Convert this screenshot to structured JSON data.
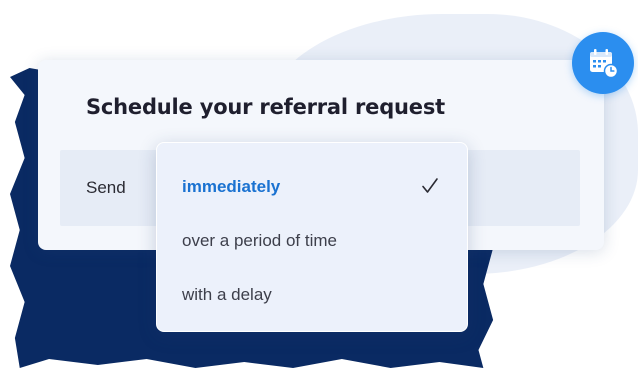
{
  "card": {
    "title": "Schedule your referral request",
    "send_label": "Send"
  },
  "dropdown": {
    "options": [
      {
        "label": "immediately",
        "selected": true
      },
      {
        "label": "over a period of time",
        "selected": false
      },
      {
        "label": "with a delay",
        "selected": false
      }
    ]
  },
  "icons": {
    "selected_check": "check-icon",
    "badge": "calendar-clock-icon"
  },
  "colors": {
    "accent": "#1a72d1",
    "badge": "#2b8eef",
    "dark_backdrop": "#0a2a63",
    "light_backdrop": "#e6ecf7"
  }
}
